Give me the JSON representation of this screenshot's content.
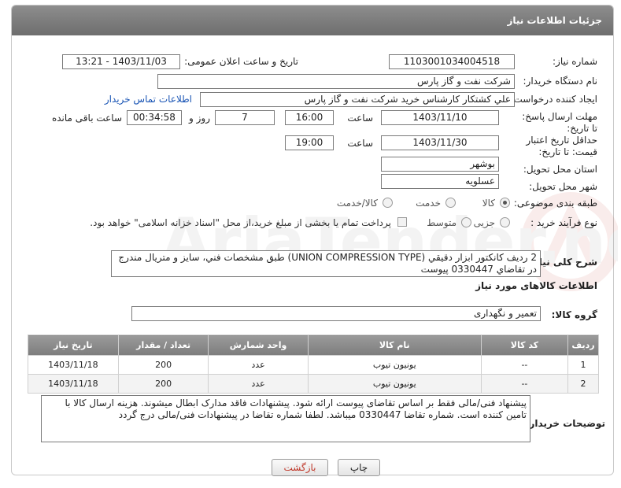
{
  "header": {
    "title": "جزئیات اطلاعات نیاز"
  },
  "fields": {
    "need_number_label": "شماره نیاز:",
    "need_number": "1103001034004518",
    "announce_label": "تاریخ و ساعت اعلان عمومی:",
    "announce_value": "1403/11/03 - 13:21",
    "buyer_org_label": "نام دستگاه خریدار:",
    "buyer_org": "شرکت نفت و گاز پارس",
    "requester_label": "ایجاد کننده درخواست:",
    "requester": "علي كشتكار كارشناس خريد شركت نفت و گاز پارس",
    "contact_link": "اطلاعات تماس خریدار",
    "deadline_label": "مهلت ارسال پاسخ: تا تاریخ:",
    "deadline_date": "1403/11/10",
    "time_label": "ساعت",
    "deadline_time": "16:00",
    "days": "7",
    "days_label": "روز و",
    "remaining": "00:34:58",
    "remaining_label": "ساعت باقی مانده",
    "validity_label": "حداقل تاریخ اعتبار قیمت: تا تاریخ:",
    "validity_date": "1403/11/30",
    "validity_time_label": "ساعت",
    "validity_time": "19:00",
    "province_label": "استان محل تحویل:",
    "province": "بوشهر",
    "city_label": "شهر محل تحویل:",
    "city": "عسلویه",
    "category_label": "طبقه بندی موضوعی:",
    "category_options": [
      "کالا",
      "خدمت",
      "کالا/خدمت"
    ],
    "process_label": "نوع فرآیند خرید :",
    "process_options": [
      "جزیی",
      "متوسط"
    ],
    "payment_note": "پرداخت تمام یا بخشی از مبلغ خرید،از محل \"اسناد خزانه اسلامی\" خواهد بود."
  },
  "description": {
    "label": "شرح کلی نیاز:",
    "text": "2 رديف كانكتور ابزار دقيقي (UNION COMPRESSION TYPE) طبق مشخصات فني، سايز و متريال مندرج در تقاضاي 0330447 پيوست"
  },
  "goods_info": {
    "title": "اطلاعات کالاهای مورد نیاز",
    "group_label": "گروه کالا:",
    "group_value": "تعمیر و نگهداری"
  },
  "table": {
    "headers": [
      "ردیف",
      "کد کالا",
      "نام کالا",
      "واحد شمارش",
      "تعداد / مقدار",
      "تاریخ نیاز"
    ],
    "rows": [
      {
        "row": "1",
        "code": "--",
        "name": "یونیون تیوب",
        "unit": "عدد",
        "qty": "200",
        "date": "1403/11/18"
      },
      {
        "row": "2",
        "code": "--",
        "name": "یونیون تیوب",
        "unit": "عدد",
        "qty": "200",
        "date": "1403/11/18"
      }
    ]
  },
  "buyer_notes": {
    "label": "توضیحات خریدار:",
    "text": "پیشنهاد فنی/مالی فقط بر اساس تقاضای پیوست ارائه شود. پیشنهادات فاقد مدارک ابطال میشوند. هزینه ارسال کالا با تامین کننده است. شماره تقاضا 0330447 میباشد. لطفا شماره تقاضا در پیشنهادات فنی/مالی درج گردد"
  },
  "buttons": {
    "print": "چاپ",
    "back": "بازگشت"
  },
  "watermark": {
    "text": "AriaTender.neT"
  },
  "colors": {
    "header_bg": "#7d7d7d",
    "link": "#1a55b5",
    "back_button_text": "#c0392b"
  }
}
